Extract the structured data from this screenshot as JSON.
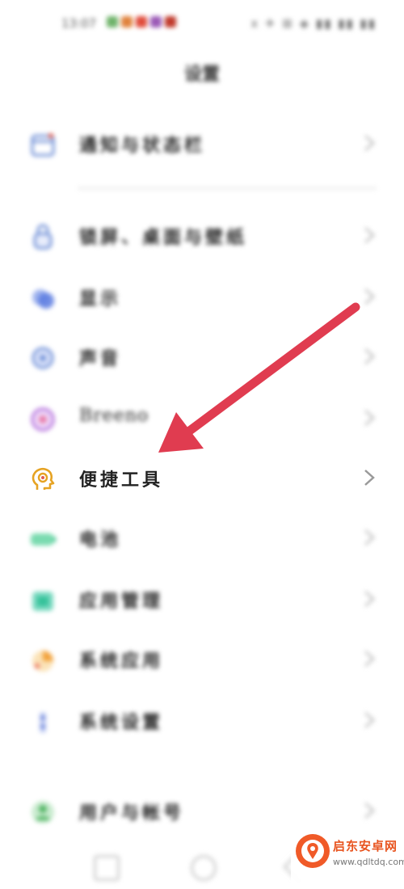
{
  "status_bar": {
    "time": "13:07",
    "right_indicators": "ⅹ ✈ ⊞ ◈ ▮▮ ▮▮ ▮▮",
    "dot_colors": [
      "#6fb36a",
      "#e0823c",
      "#e04b3b",
      "#9b59b6",
      "#c0392b"
    ]
  },
  "page_title": "设置",
  "settings": {
    "items": [
      {
        "label": "通知与状态栏",
        "icon": "calendar-icon",
        "color": "#6f8fd6",
        "blurred": true
      },
      {
        "label": "锁屏、桌面与壁纸",
        "icon": "lock-icon",
        "color": "#6f8fd6",
        "blurred": true
      },
      {
        "label": "显示",
        "icon": "display-icon",
        "color": "#5b7be0",
        "blurred": true
      },
      {
        "label": "声音",
        "icon": "sound-icon",
        "color": "#6f8fd6",
        "blurred": true
      },
      {
        "label": "Breeno",
        "icon": "breeno-icon",
        "color": "#b06ad9",
        "blurred": true
      },
      {
        "label": "便捷工具",
        "icon": "convenience-tools-icon",
        "color": "#e6a323",
        "blurred": false
      },
      {
        "label": "电池",
        "icon": "battery-icon",
        "color": "#3cc48a",
        "blurred": true
      },
      {
        "label": "应用管理",
        "icon": "apps-icon",
        "color": "#35c29a",
        "blurred": true
      },
      {
        "label": "系统应用",
        "icon": "system-apps-icon",
        "color": "#f2a23b",
        "blurred": true
      },
      {
        "label": "系统设置",
        "icon": "system-settings-icon",
        "color": "#6a82d8",
        "blurred": true
      },
      {
        "label": "用户与帐号",
        "icon": "user-account-icon",
        "color": "#53b565",
        "blurred": true
      }
    ]
  },
  "annotation": {
    "color": "#e03c50"
  },
  "watermark": {
    "name": "启东安卓网",
    "url": "www.qdltdq.com",
    "color": "#f05a28"
  }
}
